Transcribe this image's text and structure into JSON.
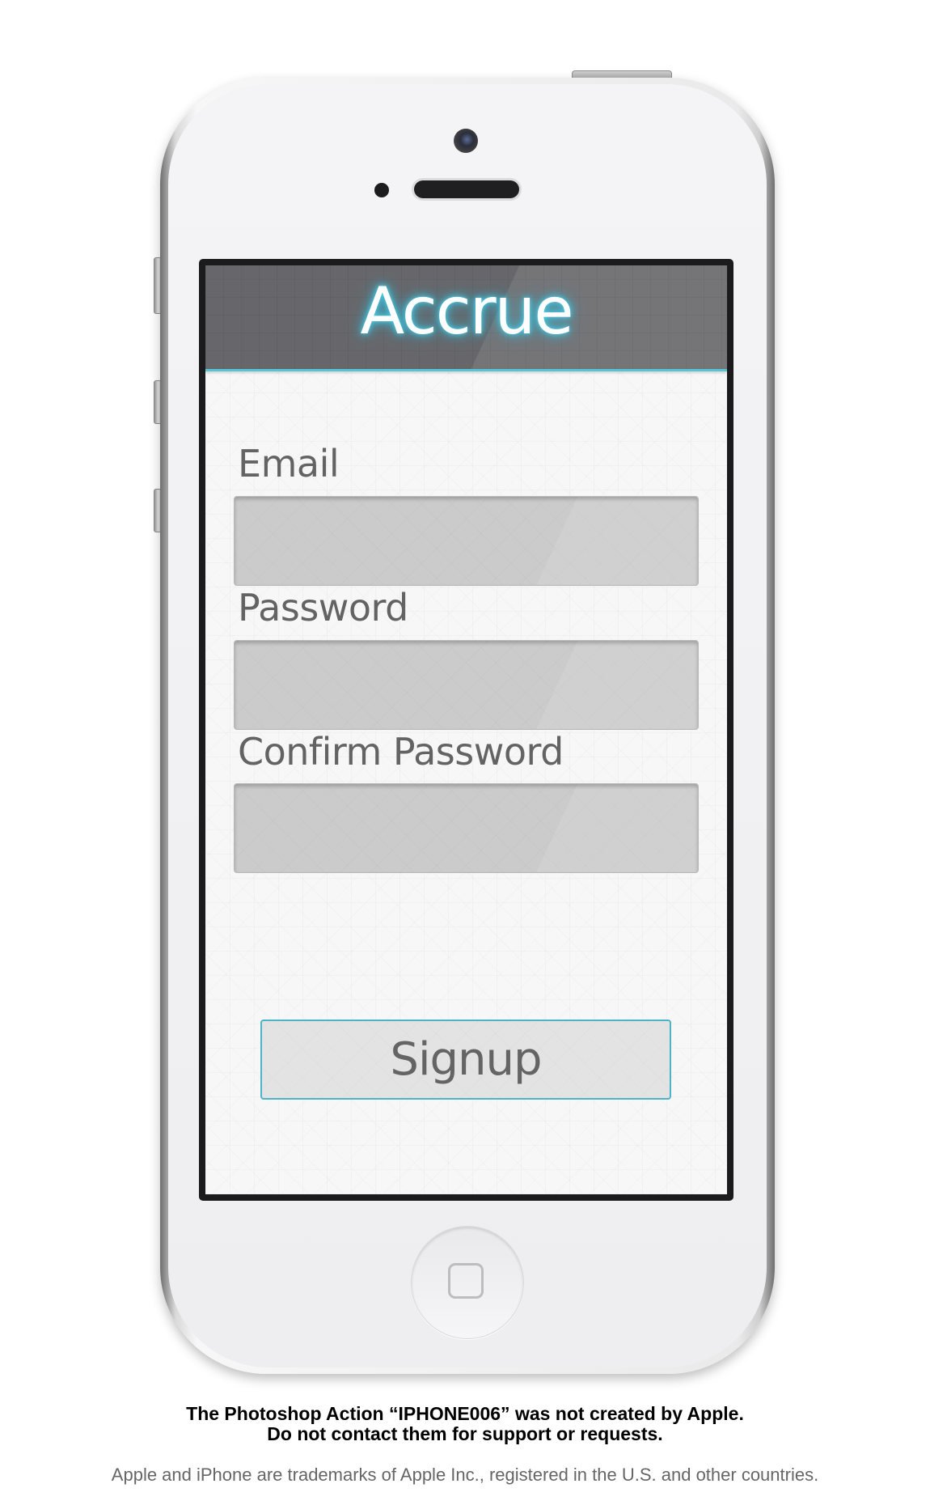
{
  "app": {
    "title": "Accrue"
  },
  "form": {
    "email_label": "Email",
    "email_value": "",
    "password_label": "Password",
    "password_value": "",
    "confirm_label": "Confirm Password",
    "confirm_value": "",
    "submit_label": "Signup"
  },
  "footer": {
    "notice_line_1": "The Photoshop Action “IPHONE006” was not created by Apple.",
    "notice_line_2": "Do not contact them for support or requests.",
    "trademark": "Apple and iPhone are trademarks of Apple Inc., registered in the U.S. and other countries."
  },
  "colors": {
    "accent": "#59c3d6",
    "header_background": "#5e5e62",
    "field_background": "#cbcbcb",
    "button_background": "#e3e3e3",
    "label_text": "#636363"
  },
  "icons": {
    "home_button": "home-square-icon",
    "camera": "front-camera-icon",
    "speaker": "earpiece-speaker-icon"
  }
}
